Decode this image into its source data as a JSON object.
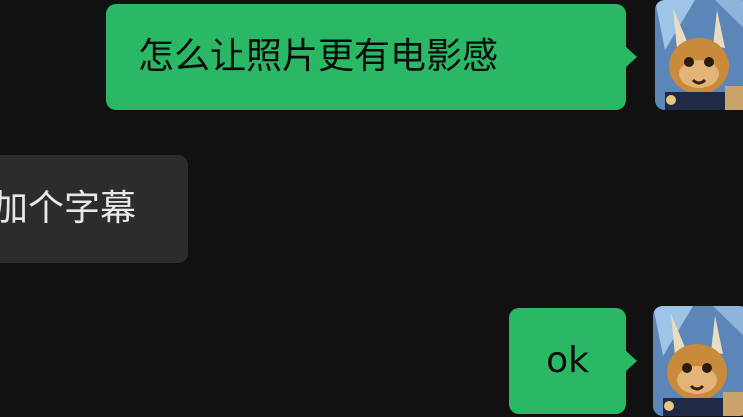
{
  "chat": {
    "messages": [
      {
        "direction": "outgoing",
        "text": "怎么让照片更有电影感"
      },
      {
        "direction": "incoming",
        "text": "加个字幕"
      },
      {
        "direction": "outgoing",
        "text": "ok"
      }
    ]
  },
  "colors": {
    "background": "#111111",
    "outgoing_bubble": "#2ab865",
    "incoming_bubble": "#2c2c2c"
  }
}
